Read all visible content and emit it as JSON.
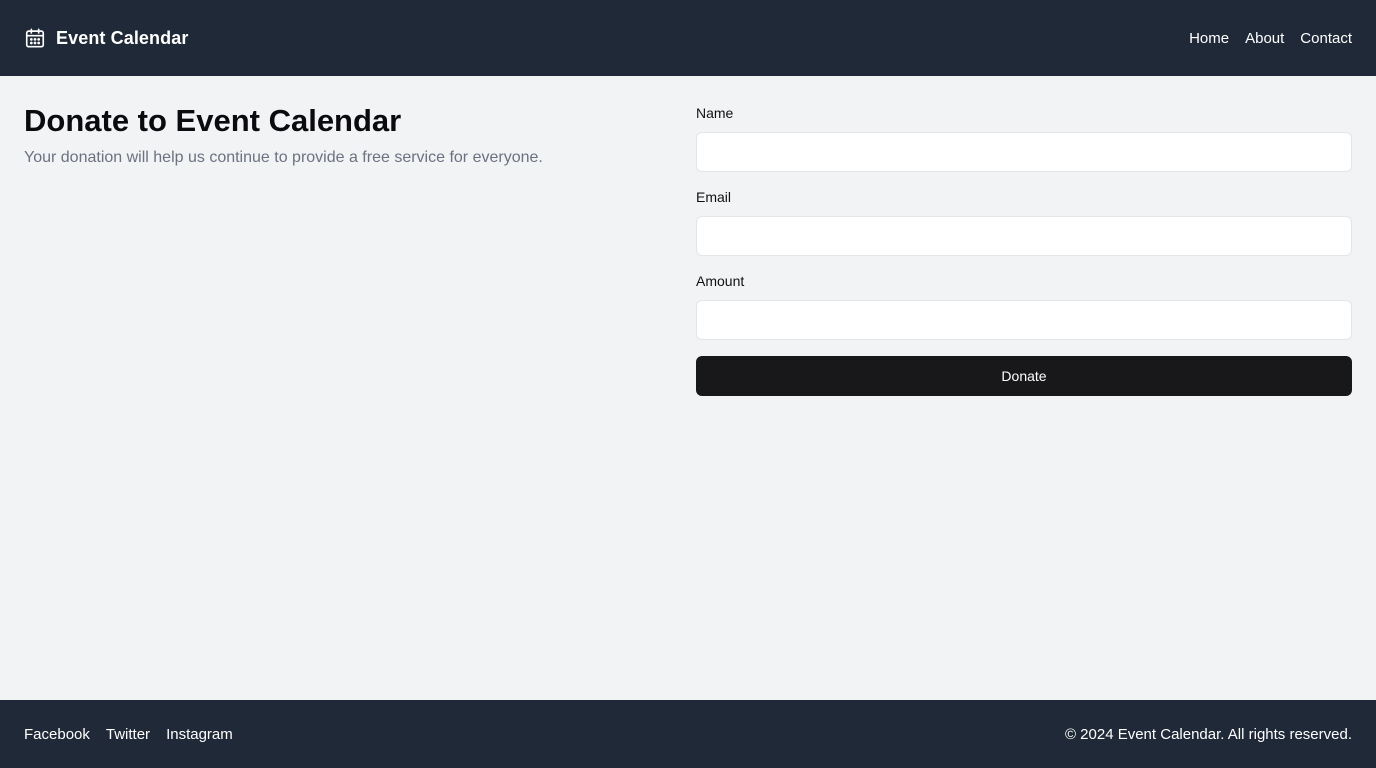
{
  "header": {
    "brand_icon": "calendar-icon",
    "brand_title": "Event Calendar",
    "nav": {
      "home": "Home",
      "about": "About",
      "contact": "Contact"
    }
  },
  "main": {
    "title": "Donate to Event Calendar",
    "subtitle": "Your donation will help us continue to provide a free service for everyone.",
    "form": {
      "name_label": "Name",
      "name_value": "",
      "email_label": "Email",
      "email_value": "",
      "amount_label": "Amount",
      "amount_value": "",
      "submit_label": "Donate"
    }
  },
  "footer": {
    "social": {
      "facebook": "Facebook",
      "twitter": "Twitter",
      "instagram": "Instagram"
    },
    "copyright": "© 2024 Event Calendar. All rights reserved."
  },
  "colors": {
    "header_bg": "#1f2937",
    "page_bg": "#f2f3f5",
    "button_bg": "#18181b",
    "subtitle_text": "#6b7280"
  }
}
